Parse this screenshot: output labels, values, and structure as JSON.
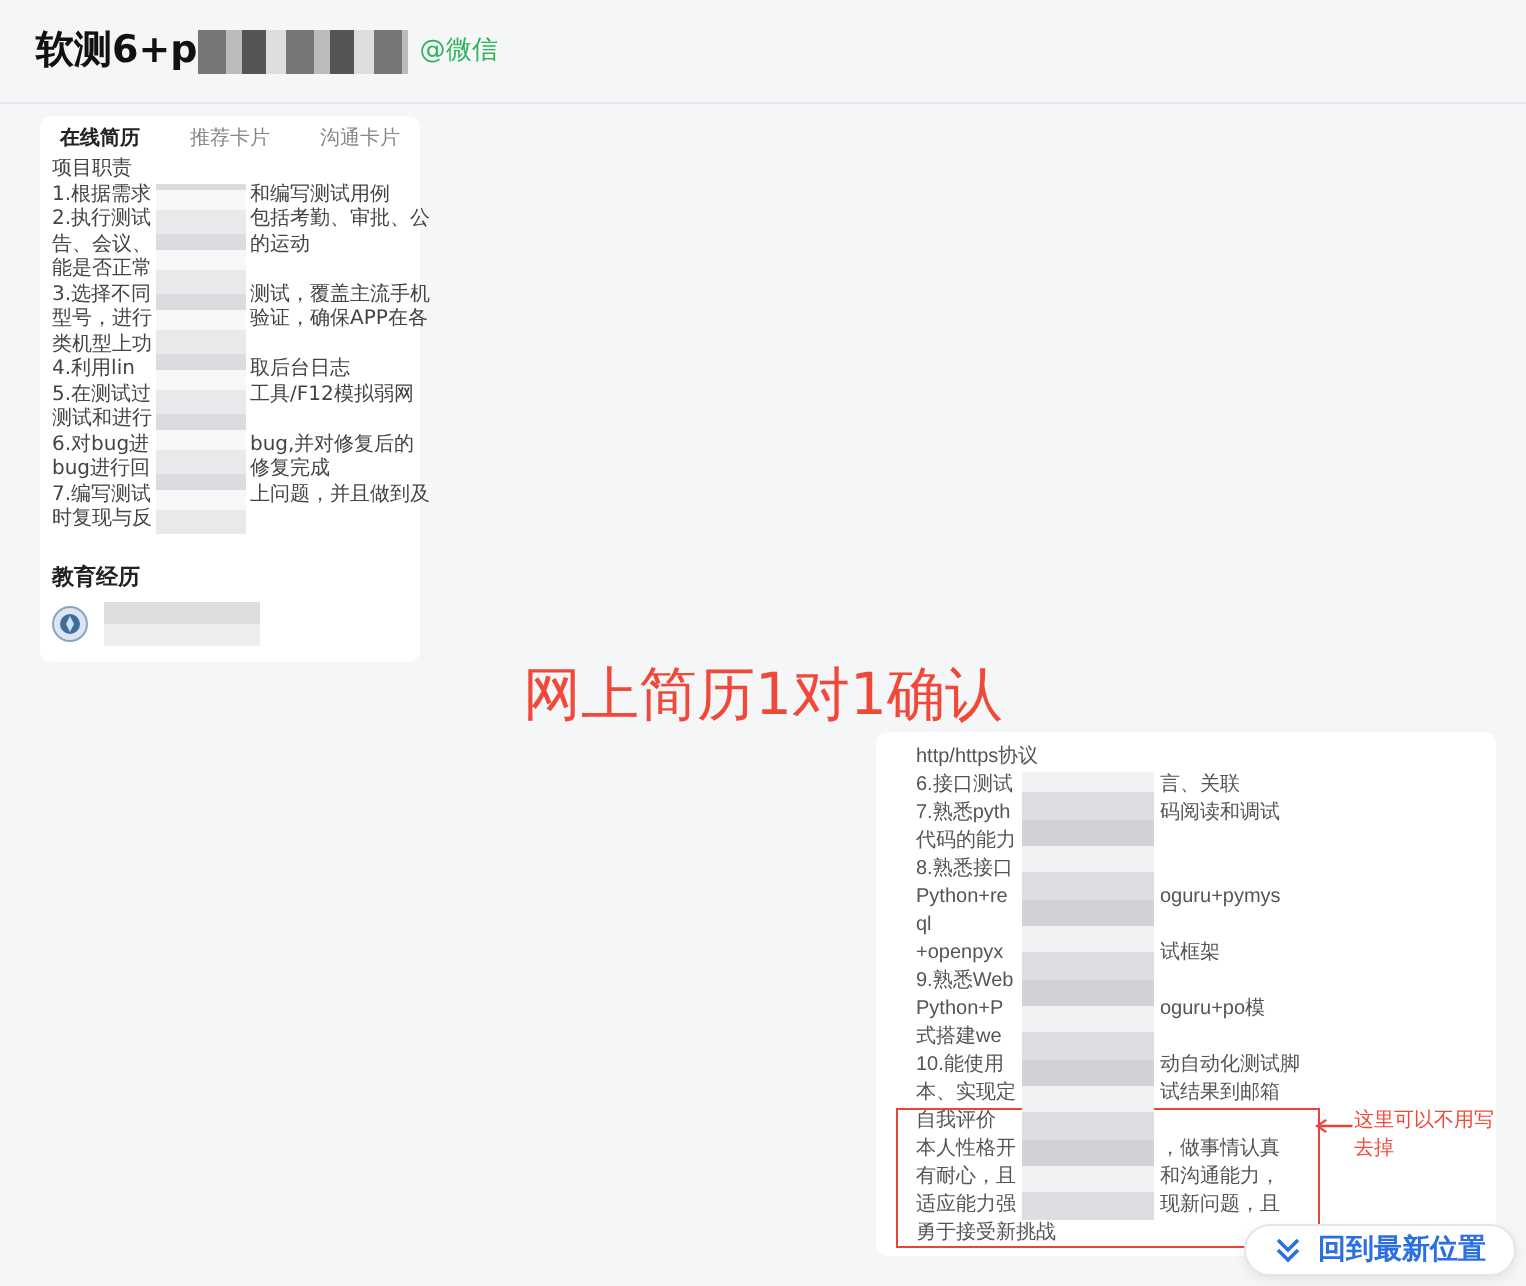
{
  "header": {
    "title": "软测6+p",
    "source": "@微信"
  },
  "resume_card": {
    "tabs": [
      {
        "label": "在线简历",
        "selected": true
      },
      {
        "label": "推荐卡片",
        "selected": false
      },
      {
        "label": "沟通卡片",
        "selected": false
      }
    ],
    "lines": [
      {
        "text": "项目职责"
      },
      {
        "left": "1.根据需求",
        "right": "和编写测试用例"
      },
      {
        "left": "2.执行测试",
        "right": "包括考勤、审批、公"
      },
      {
        "left": "告、会议、",
        "right": "的运动"
      },
      {
        "left": "能是否正常"
      },
      {
        "left": "3.选择不同",
        "right": "测试，覆盖主流手机"
      },
      {
        "left": "型号，进行",
        "right": "验证，确保APP在各"
      },
      {
        "left": "类机型上功"
      },
      {
        "left": "4.利用lin",
        "right": "取后台日志"
      },
      {
        "left": "5.在测试过",
        "right": "工具/F12模拟弱网"
      },
      {
        "left": "测试和进行"
      },
      {
        "left": "6.对bug进",
        "right": "bug,并对修复后的"
      },
      {
        "left": "bug进行回",
        "right": "修复完成"
      },
      {
        "left": "7.编写测试",
        "right": "上问题，并且做到及"
      },
      {
        "left": "时复现与反"
      }
    ],
    "education_heading": "教育经历"
  },
  "overlay_title": "网上简历1对1确认",
  "detail_card": {
    "lines": [
      {
        "text": "http/https协议"
      },
      {
        "left": "6.接口测试",
        "right": "言、关联"
      },
      {
        "left": "7.熟悉pyth",
        "right": "码阅读和调试"
      },
      {
        "left": "代码的能力"
      },
      {
        "left": "8.熟悉接口"
      },
      {
        "left": "Python+re",
        "right": "oguru+pymys"
      },
      {
        "text": "ql"
      },
      {
        "left": "+openpyx",
        "right": "试框架"
      },
      {
        "left": "9.熟悉Web"
      },
      {
        "left": "Python+P",
        "right": "oguru+po模"
      },
      {
        "left": "式搭建we"
      },
      {
        "left": "10.能使用",
        "right": "动自动化测试脚"
      },
      {
        "left": "本、实现定",
        "right": "试结果到邮箱"
      }
    ],
    "highlighted_lines": [
      {
        "text": "自我评价"
      },
      {
        "left": "本人性格开",
        "right": "，做事情认真"
      },
      {
        "left": "有耐心，且",
        "right": "和沟通能力，"
      },
      {
        "left": "适应能力强",
        "right": "现新问题，且"
      },
      {
        "text": "勇于接受新挑战"
      }
    ],
    "note": [
      "这里可以不用写",
      "去掉"
    ]
  },
  "jump_button": {
    "label": "回到最新位置"
  }
}
